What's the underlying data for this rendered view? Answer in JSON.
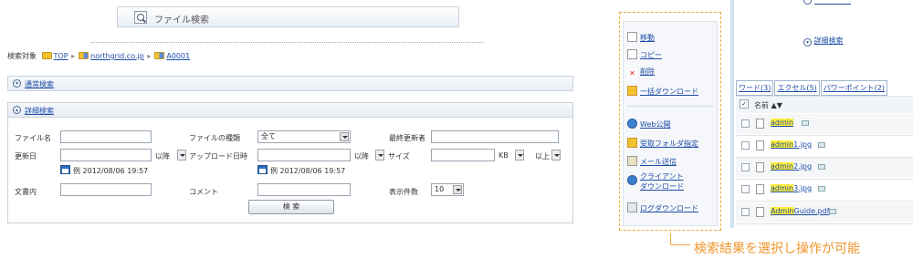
{
  "search_bar": {
    "label": "ファイル検索"
  },
  "scope": {
    "label": "検索対象",
    "crumbs": [
      "TOP",
      "northgrid.co.jp",
      "A0001"
    ]
  },
  "normal_search": {
    "label": "通常検索"
  },
  "advanced_search": {
    "label": "詳細検索",
    "file_name_label": "ファイル名",
    "file_type_label": "ファイルの種類",
    "file_type_value": "全て",
    "last_updater_label": "最終更新者",
    "updated_date_label": "更新日",
    "updated_after": "以降",
    "upload_date_label": "アップロード日時",
    "upload_after": "以降",
    "size_label": "サイズ",
    "size_unit": "KB",
    "size_cond": "以上",
    "example_updated": "例 2012/08/06 19:57",
    "example_upload": "例 2012/08/06 19:57",
    "doc_content_label": "文書内",
    "comment_label": "コメント",
    "display_count_label": "表示件数",
    "display_count_value": "10",
    "search_button": "検 索"
  },
  "results_top": {
    "top_link": "...",
    "detail_link": "詳細検索"
  },
  "menu": {
    "items": [
      {
        "label": "移動",
        "icon": "move-icon"
      },
      {
        "label": "コピー",
        "icon": "copy-icon"
      },
      {
        "label": "削除",
        "icon": "delete-icon"
      },
      {
        "label": "一括ダウンロード",
        "icon": "batch-download-icon"
      },
      {
        "label": "Web公開",
        "icon": "web-publish-icon"
      },
      {
        "label": "受取フォルダ指定",
        "icon": "receive-folder-icon"
      },
      {
        "label": "メール送信",
        "icon": "mail-icon"
      },
      {
        "label": "クライアント",
        "label2": "ダウンロード",
        "icon": "client-download-icon"
      },
      {
        "label": "ログダウンロード",
        "icon": "log-download-icon"
      }
    ]
  },
  "result_tabs": [
    "ワード(3)",
    "エクセル(5)",
    "パワーポイント(2)"
  ],
  "result_header": {
    "name": "名前 ▲▼"
  },
  "results": [
    {
      "hl": "admin",
      "rest": ""
    },
    {
      "hl": "admin",
      "rest": "1.jpg"
    },
    {
      "hl": "admin",
      "rest": "2.jpg"
    },
    {
      "hl": "admin",
      "rest": "3.jpg"
    },
    {
      "hl": "Admin",
      "rest": "Guide.pdf"
    }
  ],
  "callout": "検索結果を選択し操作が可能",
  "colors": {
    "accent": "#f0962c",
    "link": "#1f4ea8",
    "highlight": "#ffee3a"
  }
}
